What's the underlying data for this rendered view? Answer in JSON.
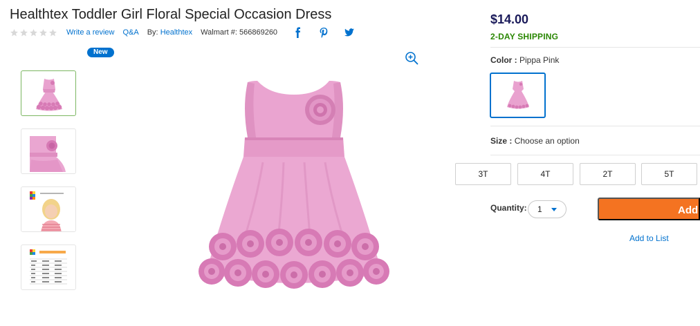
{
  "product": {
    "title": "Healthtex Toddler Girl Floral Special Occasion Dress",
    "rating_stars": 0,
    "write_review": "Write a review",
    "qa": "Q&A",
    "by_prefix": "By:",
    "brand": "Healthtex",
    "walmart_number": "Walmart #: 566869260"
  },
  "gallery": {
    "badge": "New"
  },
  "buybox": {
    "price": "$14.00",
    "shipping": "2-DAY SHIPPING",
    "color_label": "Color :",
    "color_value": "Pippa Pink",
    "size_label": "Size :",
    "size_value": "Choose an option",
    "sizes": [
      "3T",
      "4T",
      "2T",
      "5T"
    ],
    "quantity_label": "Quantity:",
    "quantity_value": "1",
    "add_button": "Add t",
    "add_to_list": "Add to List"
  },
  "colors": {
    "accent": "#0071ce",
    "cta": "#f47321",
    "shipping": "#2a8703",
    "dress": "#e68fc4"
  }
}
